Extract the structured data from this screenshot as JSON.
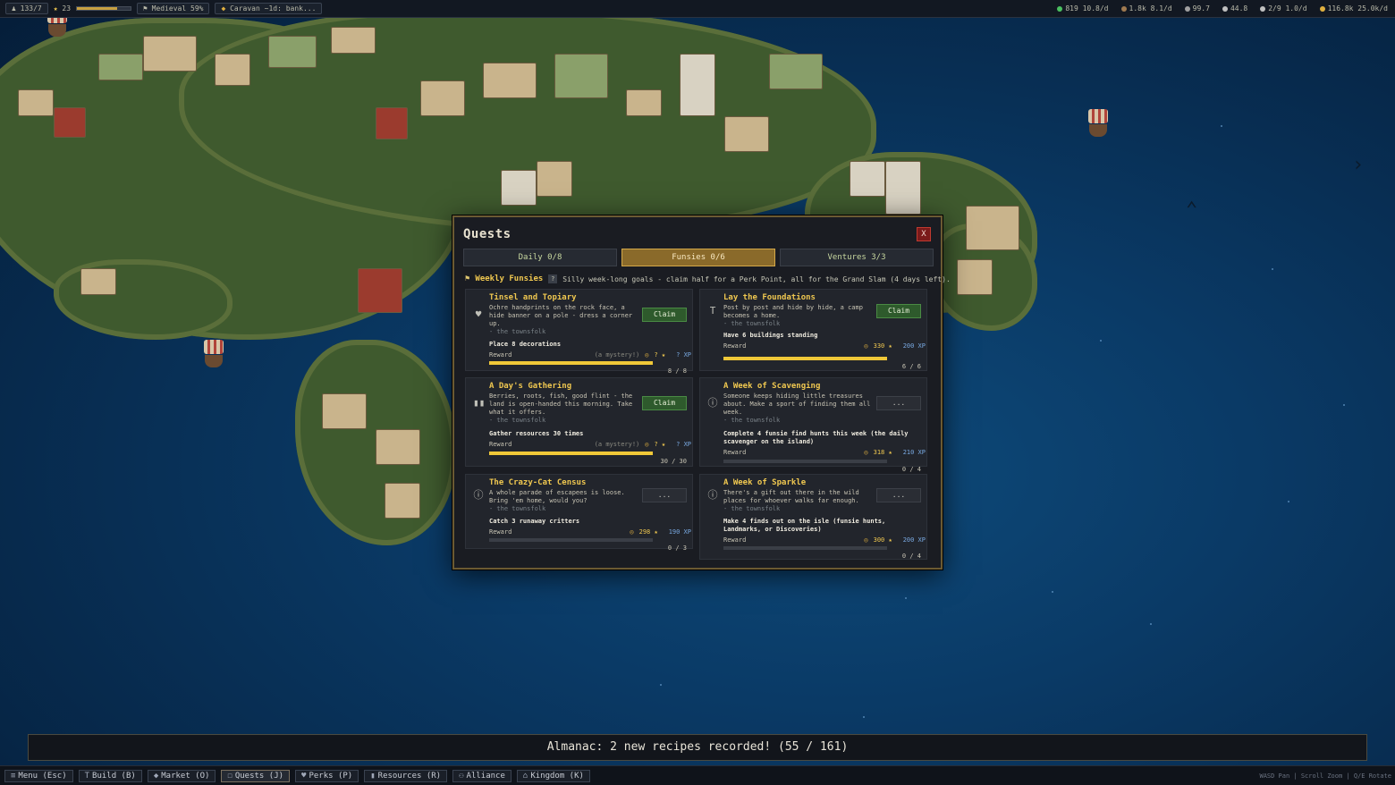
{
  "topbar": {
    "player_label": "133/7",
    "level_label": "23",
    "xp_fraction": 0.75,
    "era_label": "Medieval 59%",
    "caravan_label": "Caravan ~1d: bank...",
    "resources": [
      {
        "icon": "food-icon",
        "text": "819 10.8/d",
        "color": "#4ac060"
      },
      {
        "icon": "wood-icon",
        "text": "1.8k 8.1/d",
        "color": "#a07a50"
      },
      {
        "icon": "stone-icon",
        "text": "99.7",
        "color": "#a0a0a0"
      },
      {
        "icon": "tools-icon",
        "text": "44.8",
        "color": "#c0c0c0"
      },
      {
        "icon": "population-icon",
        "text": "2/9 1.0/d",
        "color": "#c0c0c0"
      },
      {
        "icon": "gold-icon",
        "text": "116.8k 25.0k/d",
        "color": "#e0b040"
      }
    ]
  },
  "modal": {
    "title": "Quests",
    "close_label": "X",
    "tabs": [
      {
        "label": "Daily 0/8",
        "active": false
      },
      {
        "label": "Funsies 0/6",
        "active": true
      },
      {
        "label": "Ventures 3/3",
        "active": false
      }
    ],
    "section": {
      "title": "Weekly Funsies",
      "help": "?",
      "description": "Silly week-long goals - claim half for a Perk Point, all for the Grand Slam (4 days left)."
    },
    "quests": [
      {
        "icon": "heart-icon",
        "title": "Tinsel and Topiary",
        "description": "Ochre handprints on the rock face, a hide banner on a pole - dress a corner up.",
        "author": "- the townsfolk",
        "goal": "Place 8 decorations",
        "reward_label": "Reward",
        "reward_mystery": "(a mystery!)",
        "reward_coins": "?",
        "reward_xp": "? XP",
        "progress_text": "8 / 8",
        "progress": 1.0,
        "button": "Claim"
      },
      {
        "icon": "hammer-icon",
        "title": "Lay the Foundations",
        "description": "Post by post and hide by hide, a camp becomes a home.",
        "author": "- the townsfolk",
        "goal": "Have 6 buildings standing",
        "reward_label": "Reward",
        "reward_mystery": "",
        "reward_coins": "330",
        "reward_xp": "200 XP",
        "progress_text": "6 / 6",
        "progress": 1.0,
        "button": "Claim"
      },
      {
        "icon": "bar-chart-icon",
        "title": "A Day's Gathering",
        "description": "Berries, roots, fish, good flint - the land is open-handed this morning. Take what it offers.",
        "author": "- the townsfolk",
        "goal": "Gather resources 30 times",
        "reward_label": "Reward",
        "reward_mystery": "(a mystery!)",
        "reward_coins": "?",
        "reward_xp": "? XP",
        "progress_text": "30 / 30",
        "progress": 1.0,
        "button": "Claim"
      },
      {
        "icon": "info-icon",
        "title": "A Week of Scavenging",
        "description": "Someone keeps hiding little treasures about. Make a sport of finding them all week.",
        "author": "- the townsfolk",
        "goal": "Complete 4 funsie find hunts this week (the daily scavenger on the island)",
        "reward_label": "Reward",
        "reward_mystery": "",
        "reward_coins": "318",
        "reward_xp": "210 XP",
        "progress_text": "0 / 4",
        "progress": 0.0,
        "button": "..."
      },
      {
        "icon": "info-icon",
        "title": "The Crazy-Cat Census",
        "description": "A whole parade of escapees is loose. Bring 'em home, would you?",
        "author": "- the townsfolk",
        "goal": "Catch 3 runaway critters",
        "reward_label": "Reward",
        "reward_mystery": "",
        "reward_coins": "298",
        "reward_xp": "190 XP",
        "progress_text": "0 / 3",
        "progress": 0.0,
        "button": "..."
      },
      {
        "icon": "info-icon",
        "title": "A Week of Sparkle",
        "description": "There's a gift out there in the wild places for whoever walks far enough.",
        "author": "- the townsfolk",
        "goal": "Make 4 finds out on the isle (funsie hunts, Landmarks, or Discoveries)",
        "reward_label": "Reward",
        "reward_mystery": "",
        "reward_coins": "300",
        "reward_xp": "200 XP",
        "progress_text": "0 / 4",
        "progress": 0.0,
        "button": "..."
      }
    ]
  },
  "notice": "Almanac: 2 new recipes recorded!  (55 / 161)",
  "bottombar": {
    "buttons": [
      {
        "icon": "menu-icon",
        "label": "Menu (Esc)",
        "active": false
      },
      {
        "icon": "build-icon",
        "label": "Build (B)",
        "active": false
      },
      {
        "icon": "market-icon",
        "label": "Market (O)",
        "active": false
      },
      {
        "icon": "quests-icon",
        "label": "Quests (J)",
        "active": true
      },
      {
        "icon": "perks-icon",
        "label": "Perks (P)",
        "active": false
      },
      {
        "icon": "resources-icon",
        "label": "Resources (R)",
        "active": false
      },
      {
        "icon": "alliance-icon",
        "label": "Alliance",
        "active": false
      },
      {
        "icon": "kingdom-icon",
        "label": "Kingdom (K)",
        "active": false
      }
    ],
    "hint": "WASD Pan | Scroll Zoom | Q/E Rotate"
  }
}
